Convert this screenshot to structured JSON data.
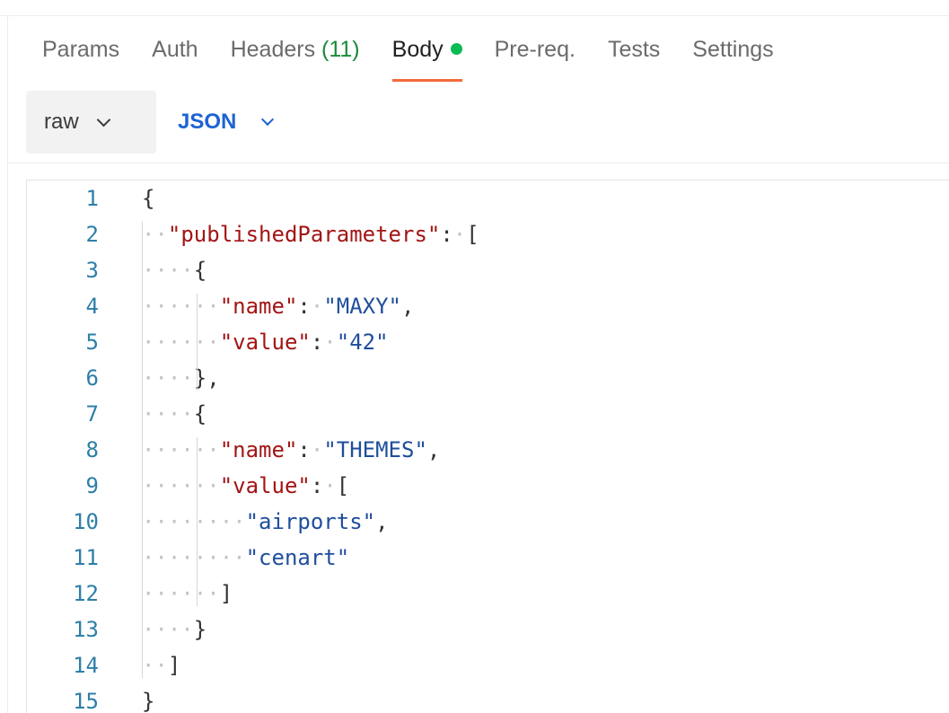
{
  "tabs": [
    {
      "label": "Params"
    },
    {
      "label": "Auth"
    },
    {
      "label": "Headers ",
      "count": "(11)"
    },
    {
      "label": "Body",
      "active": true
    },
    {
      "label": "Pre-req."
    },
    {
      "label": "Tests"
    },
    {
      "label": "Settings"
    }
  ],
  "body_mode": {
    "label": "raw"
  },
  "body_format": {
    "label": "JSON"
  },
  "colors": {
    "active_tab_underline": "#f26b3a",
    "body_dot": "#0cbb52",
    "headers_count": "#1b8a3a",
    "json_accent": "#1d63d3",
    "key_string": "#a31515",
    "value_string": "#1f4e9c",
    "line_number": "#2d7fa8"
  },
  "editor": {
    "lines": [
      {
        "n": "1",
        "tokens": [
          {
            "t": "{",
            "c": "punct"
          }
        ]
      },
      {
        "n": "2",
        "tokens": [
          {
            "t": "··",
            "c": "ws"
          },
          {
            "t": "\"publishedParameters\"",
            "c": "str-key"
          },
          {
            "t": ":",
            "c": "punct"
          },
          {
            "t": "·",
            "c": "ws"
          },
          {
            "t": "[",
            "c": "punct"
          }
        ]
      },
      {
        "n": "3",
        "tokens": [
          {
            "t": "····",
            "c": "ws"
          },
          {
            "t": "{",
            "c": "punct"
          }
        ]
      },
      {
        "n": "4",
        "tokens": [
          {
            "t": "······",
            "c": "ws"
          },
          {
            "t": "\"name\"",
            "c": "str-key"
          },
          {
            "t": ":",
            "c": "punct"
          },
          {
            "t": "·",
            "c": "ws"
          },
          {
            "t": "\"MAXY\"",
            "c": "str-val"
          },
          {
            "t": ",",
            "c": "punct"
          }
        ]
      },
      {
        "n": "5",
        "tokens": [
          {
            "t": "······",
            "c": "ws"
          },
          {
            "t": "\"value\"",
            "c": "str-key"
          },
          {
            "t": ":",
            "c": "punct"
          },
          {
            "t": "·",
            "c": "ws"
          },
          {
            "t": "\"42\"",
            "c": "str-val"
          }
        ]
      },
      {
        "n": "6",
        "tokens": [
          {
            "t": "····",
            "c": "ws"
          },
          {
            "t": "},",
            "c": "punct"
          }
        ]
      },
      {
        "n": "7",
        "tokens": [
          {
            "t": "····",
            "c": "ws"
          },
          {
            "t": "{",
            "c": "punct"
          }
        ]
      },
      {
        "n": "8",
        "tokens": [
          {
            "t": "······",
            "c": "ws"
          },
          {
            "t": "\"name\"",
            "c": "str-key"
          },
          {
            "t": ":",
            "c": "punct"
          },
          {
            "t": "·",
            "c": "ws"
          },
          {
            "t": "\"THEMES\"",
            "c": "str-val"
          },
          {
            "t": ",",
            "c": "punct"
          }
        ]
      },
      {
        "n": "9",
        "tokens": [
          {
            "t": "······",
            "c": "ws"
          },
          {
            "t": "\"value\"",
            "c": "str-key"
          },
          {
            "t": ":",
            "c": "punct"
          },
          {
            "t": "·",
            "c": "ws"
          },
          {
            "t": "[",
            "c": "punct"
          }
        ]
      },
      {
        "n": "10",
        "tokens": [
          {
            "t": "········",
            "c": "ws"
          },
          {
            "t": "\"airports\"",
            "c": "str-val"
          },
          {
            "t": ",",
            "c": "punct"
          }
        ]
      },
      {
        "n": "11",
        "tokens": [
          {
            "t": "········",
            "c": "ws"
          },
          {
            "t": "\"cenart\"",
            "c": "str-val"
          }
        ]
      },
      {
        "n": "12",
        "tokens": [
          {
            "t": "······",
            "c": "ws"
          },
          {
            "t": "]",
            "c": "punct"
          }
        ]
      },
      {
        "n": "13",
        "tokens": [
          {
            "t": "····",
            "c": "ws"
          },
          {
            "t": "}",
            "c": "punct"
          }
        ]
      },
      {
        "n": "14",
        "tokens": [
          {
            "t": "··",
            "c": "ws"
          },
          {
            "t": "]",
            "c": "punct"
          }
        ]
      },
      {
        "n": "15",
        "tokens": [
          {
            "t": "}",
            "c": "punct"
          }
        ]
      }
    ]
  }
}
